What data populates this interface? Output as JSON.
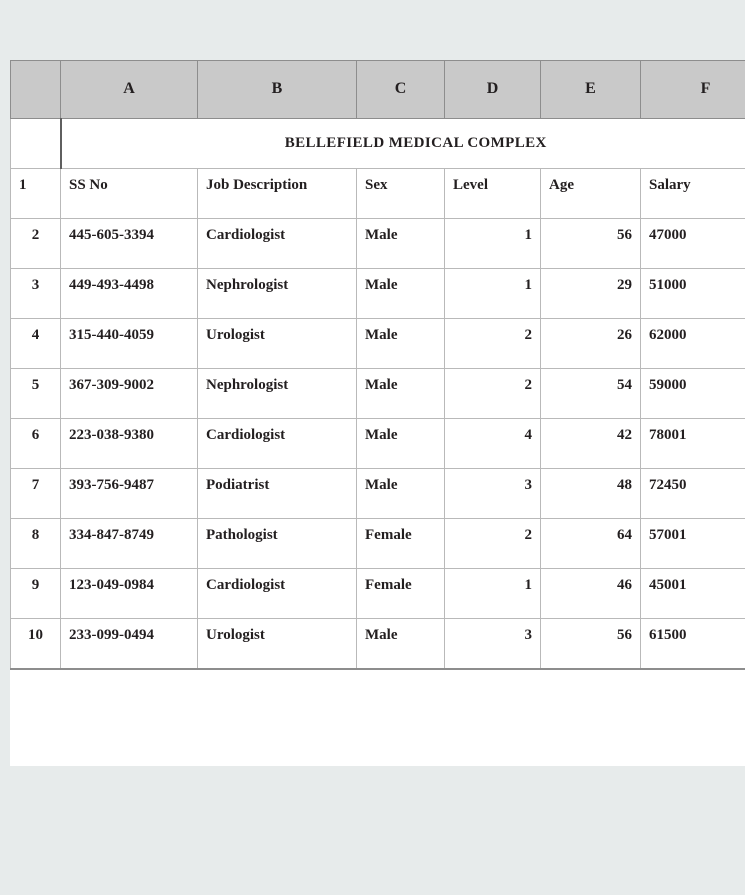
{
  "sheet": {
    "column_headers": [
      "A",
      "B",
      "C",
      "D",
      "E",
      "F"
    ],
    "title": "BELLEFIELD MEDICAL COMPLEX",
    "field_headers": [
      "SS No",
      "Job Description",
      "Sex",
      "Level",
      "Age",
      "Salary"
    ],
    "row_numbers": [
      "1",
      "2",
      "3",
      "4",
      "5",
      "6",
      "7",
      "8",
      "9",
      "10"
    ],
    "rows": [
      {
        "row": "2",
        "ss_no": "445-605-3394",
        "job_description": "Cardiologist",
        "sex": "Male",
        "level": "1",
        "age": "56",
        "salary": "47000"
      },
      {
        "row": "3",
        "ss_no": "449-493-4498",
        "job_description": "Nephrologist",
        "sex": "Male",
        "level": "1",
        "age": "29",
        "salary": "51000"
      },
      {
        "row": "4",
        "ss_no": "315-440-4059",
        "job_description": "Urologist",
        "sex": "Male",
        "level": "2",
        "age": "26",
        "salary": "62000"
      },
      {
        "row": "5",
        "ss_no": "367-309-9002",
        "job_description": "Nephrologist",
        "sex": "Male",
        "level": "2",
        "age": "54",
        "salary": "59000"
      },
      {
        "row": "6",
        "ss_no": "223-038-9380",
        "job_description": "Cardiologist",
        "sex": "Male",
        "level": "4",
        "age": "42",
        "salary": "78001"
      },
      {
        "row": "7",
        "ss_no": "393-756-9487",
        "job_description": "Podiatrist",
        "sex": "Male",
        "level": "3",
        "age": "48",
        "salary": "72450"
      },
      {
        "row": "8",
        "ss_no": "334-847-8749",
        "job_description": "Pathologist",
        "sex": "Female",
        "level": "2",
        "age": "64",
        "salary": "57001"
      },
      {
        "row": "9",
        "ss_no": "123-049-0984",
        "job_description": "Cardiologist",
        "sex": "Female",
        "level": "1",
        "age": "46",
        "salary": "45001"
      },
      {
        "row": "10",
        "ss_no": "233-099-0494",
        "job_description": "Urologist",
        "sex": "Male",
        "level": "3",
        "age": "56",
        "salary": "61500"
      }
    ]
  },
  "colors": {
    "page_background": "#e7ebeb",
    "header_fill": "#c9c9c9",
    "cell_fill": "#ffffff",
    "grid_line": "#b9b9b9",
    "heavy_line": "#5f5f5f",
    "text": "#231f20"
  }
}
